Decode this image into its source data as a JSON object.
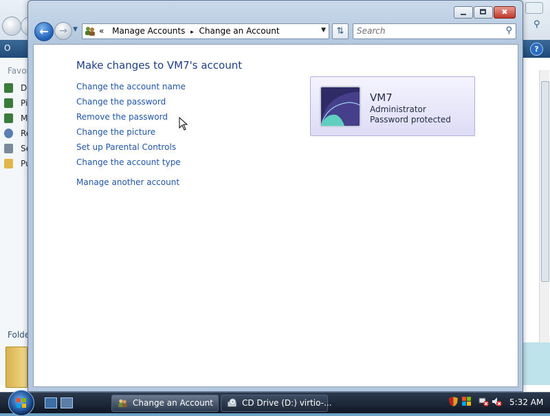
{
  "background_window": {
    "toolbar_label": "O",
    "help_glyph": "?",
    "favorites_label": "Favor",
    "sidebar_items": [
      {
        "label": "De",
        "icon": "desktop-icon"
      },
      {
        "label": "Pi",
        "icon": "pictures-icon"
      },
      {
        "label": "M",
        "icon": "music-icon"
      },
      {
        "label": "Re",
        "icon": "recent-icon"
      },
      {
        "label": "Se",
        "icon": "searches-icon"
      },
      {
        "label": "Pu",
        "icon": "public-folder-icon"
      }
    ],
    "folders_label": "Folde"
  },
  "window": {
    "address": {
      "overflow_glyph": "«",
      "crumbs": [
        "Manage Accounts",
        "Change an Account"
      ],
      "separator": "▸"
    },
    "search": {
      "placeholder": "Search"
    },
    "heading": "Make changes to VM7's account",
    "links": [
      "Change the account name",
      "Change the password",
      "Remove the password",
      "Change the picture",
      "Set up Parental Controls",
      "Change the account type"
    ],
    "manage_link": "Manage another account",
    "account": {
      "name": "VM7",
      "type": "Administrator",
      "status": "Password protected"
    }
  },
  "taskbar": {
    "buttons": [
      {
        "label": "Change an Account",
        "icon": "user-accounts-icon",
        "active": true
      },
      {
        "label": "CD Drive (D:) virtio-...",
        "icon": "cd-drive-icon",
        "active": false
      }
    ],
    "clock": "5:32 AM"
  },
  "colors": {
    "link": "#1f56a8",
    "heading": "#1e3f86",
    "taskbar": "#1d2838",
    "account_tile": "#dedcf6"
  }
}
